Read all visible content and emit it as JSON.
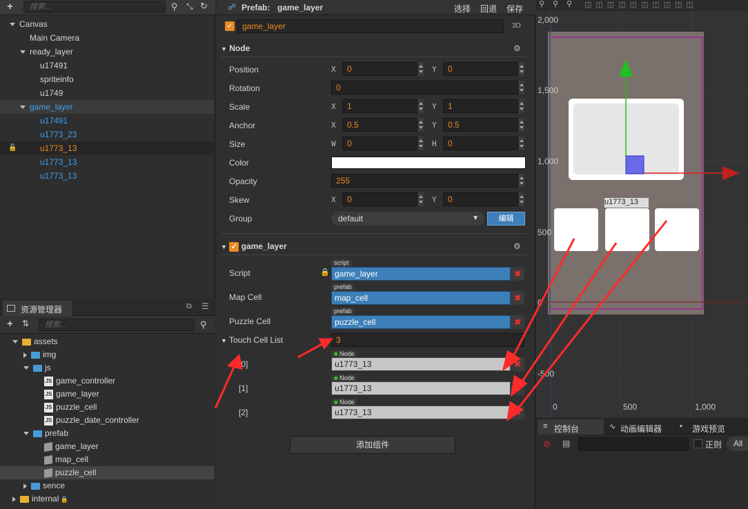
{
  "hierarchy": {
    "search_placeholder": "搜索...",
    "nodes": [
      {
        "label": "Canvas",
        "state": "open",
        "indent": 0,
        "color": "#d6d6d6"
      },
      {
        "label": "Main Camera",
        "state": "leaf",
        "indent": 1,
        "color": "#d6d6d6"
      },
      {
        "label": "ready_layer",
        "state": "open",
        "indent": 1,
        "color": "#d6d6d6"
      },
      {
        "label": "u17491",
        "state": "leaf",
        "indent": 2,
        "color": "#d6d6d6"
      },
      {
        "label": "spriteinfo",
        "state": "leaf",
        "indent": 2,
        "color": "#d6d6d6"
      },
      {
        "label": "u1749",
        "state": "leaf",
        "indent": 2,
        "color": "#d6d6d6"
      },
      {
        "label": "game_layer",
        "state": "open",
        "indent": 1,
        "color": "#3ea0f0"
      },
      {
        "label": "u17491",
        "state": "leaf",
        "indent": 2,
        "color": "#3ea0f0"
      },
      {
        "label": "u1773_23",
        "state": "leaf",
        "indent": 2,
        "color": "#3ea0f0"
      },
      {
        "label": "u1773_13",
        "state": "leaf",
        "indent": 2,
        "color": "#e98a24"
      },
      {
        "label": "u1773_13",
        "state": "leaf",
        "indent": 2,
        "color": "#3ea0f0"
      },
      {
        "label": "u1773_13",
        "state": "leaf",
        "indent": 2,
        "color": "#3ea0f0"
      }
    ]
  },
  "assets": {
    "title": "资源管理器",
    "search_placeholder": "搜索...",
    "items": [
      {
        "label": "assets",
        "type": "root",
        "indent": 0
      },
      {
        "label": "img",
        "type": "folder-closed",
        "indent": 1
      },
      {
        "label": "js",
        "type": "folder-open",
        "indent": 1
      },
      {
        "label": "game_controller",
        "type": "js",
        "indent": 2
      },
      {
        "label": "game_layer",
        "type": "js",
        "indent": 2
      },
      {
        "label": "puzzle_cell",
        "type": "js",
        "indent": 2
      },
      {
        "label": "puzzle_date_controller",
        "type": "js",
        "indent": 2
      },
      {
        "label": "prefab",
        "type": "folder-open",
        "indent": 1
      },
      {
        "label": "game_layer",
        "type": "prefab",
        "indent": 2
      },
      {
        "label": "map_cell",
        "type": "prefab",
        "indent": 2
      },
      {
        "label": "puzzle_cell",
        "type": "prefab",
        "indent": 2
      },
      {
        "label": "sence",
        "type": "folder-closed",
        "indent": 1
      },
      {
        "label": "internal",
        "type": "root-locked",
        "indent": 0
      }
    ]
  },
  "inspector": {
    "prefab_label": "Prefab:",
    "prefab_name": "game_layer",
    "select": "选择",
    "revert": "回退",
    "save": "保存",
    "node_name": "game_layer",
    "mode_3d": "3D",
    "node_section": "Node",
    "position": {
      "label": "Position",
      "x": "0",
      "y": "0"
    },
    "rotation": {
      "label": "Rotation",
      "value": "0"
    },
    "scale": {
      "label": "Scale",
      "x": "1",
      "y": "1"
    },
    "anchor": {
      "label": "Anchor",
      "x": "0.5",
      "y": "0.5"
    },
    "size": {
      "label": "Size",
      "w": "0",
      "h": "0"
    },
    "color": {
      "label": "Color",
      "value": "#ffffff"
    },
    "opacity": {
      "label": "Opacity",
      "value": "255"
    },
    "skew": {
      "label": "Skew",
      "x": "0",
      "y": "0"
    },
    "group": {
      "label": "Group",
      "value": "default",
      "edit": "编辑"
    },
    "axis_x": "X",
    "axis_y": "Y",
    "axis_w": "W",
    "axis_h": "H",
    "component": {
      "name": "game_layer",
      "script": {
        "label": "Script",
        "tag": "script",
        "value": "game_layer"
      },
      "map_cell": {
        "label": "Map Cell",
        "tag": "prefab",
        "value": "map_cell"
      },
      "puzzle_cell": {
        "label": "Puzzle Cell",
        "tag": "prefab",
        "value": "puzzle_cell"
      },
      "touch_list": {
        "label": "Touch Cell List",
        "count": "3",
        "items": [
          {
            "index": "[0]",
            "tag": "Node",
            "value": "u1773_13"
          },
          {
            "index": "[1]",
            "tag": "Node",
            "value": "u1773_13"
          },
          {
            "index": "[2]",
            "tag": "Node",
            "value": "u1773_13"
          }
        ]
      }
    },
    "add_component": "添加组件"
  },
  "scene": {
    "y_ticks": [
      "2,000",
      "1,500",
      "1,000",
      "500",
      "0",
      "-500"
    ],
    "x_ticks": [
      "0",
      "500",
      "1,000"
    ],
    "selected_label": "u1773_13"
  },
  "console": {
    "tabs": [
      "控制台",
      "动画编辑器",
      "游戏预览"
    ],
    "regex": "正则",
    "all": "All"
  },
  "colors": {
    "accent": "#e98a24",
    "selection": "#3ea0f0",
    "arrow": "#ff2b2b"
  }
}
